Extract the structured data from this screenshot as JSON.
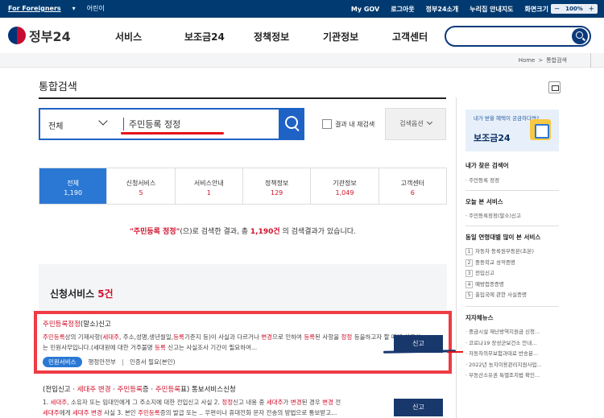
{
  "topbar": {
    "for_foreigners": "For Foreigners",
    "kids": "어린이",
    "mygov": "My GOV",
    "logout": "로그아웃",
    "gov24_intro": "정부24소개",
    "guide_map": "누리집 안내지도",
    "zoom_label": "화면크기",
    "zoom_value": "－　100%　＋"
  },
  "header": {
    "logo_text": "정부24",
    "nav": [
      "서비스",
      "보조금24",
      "정책정보",
      "기관정보",
      "고객센터"
    ]
  },
  "breadcrumb": {
    "home": "Home",
    "sep": ">",
    "current": "통합검색"
  },
  "page": {
    "title": "통합검색"
  },
  "search": {
    "scope": "전체",
    "query": "주민등록 정정",
    "within_label": "결과 내 재검색",
    "options_label": "검색옵션"
  },
  "tabs": [
    {
      "label": "전체",
      "count": "1,190"
    },
    {
      "label": "신청서비스",
      "count": "5"
    },
    {
      "label": "서비스안내",
      "count": "1"
    },
    {
      "label": "정책정보",
      "count": "129"
    },
    {
      "label": "기관정보",
      "count": "1,049"
    },
    {
      "label": "고객센터",
      "count": "6"
    }
  ],
  "result_msg": {
    "query": "\"주민등록 정정\"",
    "text1": "(으)로 검색한 결과, 총 ",
    "total": "1,190건",
    "text2": " 의 검색결과가 있습니다."
  },
  "section": {
    "title": "신청서비스",
    "count": "5건"
  },
  "items": [
    {
      "title": "주민등록정정(말소)신고",
      "tag": "민원서비스",
      "agency": "행정안전부",
      "auth": "인증서 필요(본인)",
      "apply": "신고"
    },
    {
      "title": "(전입신고 · 세대주 변경 · 주민등록증 · 주민등록표) 통보서비스신청",
      "apply": "신고"
    }
  ],
  "sidebar": {
    "banner_sub": "내가 받을 혜택이 궁금하다면?",
    "banner_title": "보조금24",
    "recent_title": "내가 찾은 검색어",
    "recent": [
      "주민등록 정정"
    ],
    "today_title": "오늘 본 서비스",
    "today": [
      "주민등록정정(말소)신고"
    ],
    "peer_title": "동일 연령대별 많이 본 서비스",
    "peer": [
      "자동차 등록원부등본(초본)",
      "중등학교 성적증명",
      "전입신고",
      "예방접종증명",
      "출입국에 관한 사실증명"
    ],
    "news_title": "지자체뉴스",
    "news": [
      "중금시설 재난방역지원금 신청...",
      "코로나19 장성군보건소 안내...",
      "자동차의무보험과태료 반송분...",
      "2022년 농지이용관리지원사업...",
      "부동산소유권 특별조치법 확인..."
    ]
  },
  "colors": {
    "navy": "#003a70",
    "accent": "#1f62c6",
    "red": "#d0112b",
    "highlight_box": "#ef3b44"
  }
}
